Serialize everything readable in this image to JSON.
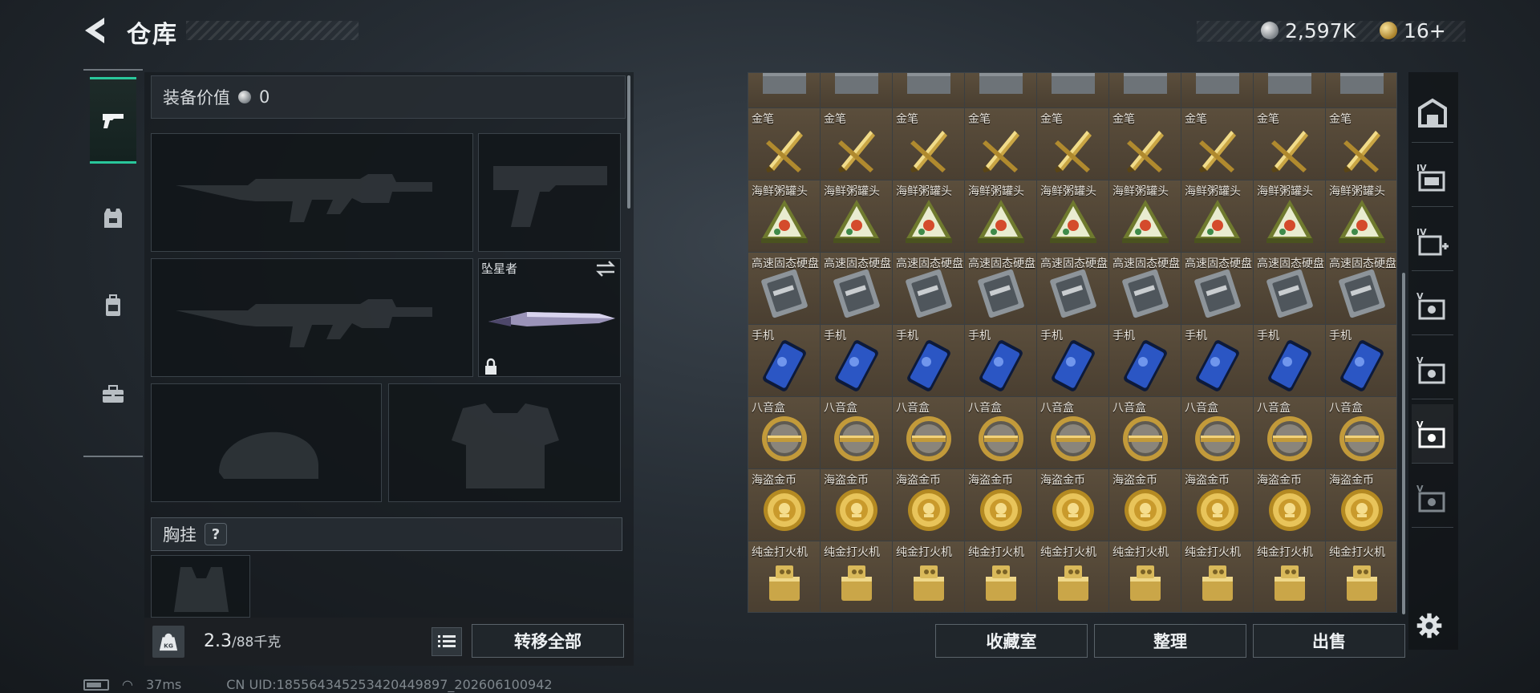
{
  "header": {
    "title": "仓库",
    "currency_silver": "2,597K",
    "currency_gold": "16+"
  },
  "sidebar": {
    "categories": [
      {
        "name": "pistol",
        "active": true
      },
      {
        "name": "armor-vest",
        "active": false
      },
      {
        "name": "backpack",
        "active": false
      },
      {
        "name": "toolbox",
        "active": false
      }
    ]
  },
  "equipment": {
    "value_label": "装备价值",
    "value": "0",
    "melee_name": "坠星者",
    "chest_rig_label": "胸挂",
    "help_mark": "?"
  },
  "weight": {
    "current": "2.3",
    "max": "/88千克"
  },
  "buttons": {
    "transfer_all": "转移全部",
    "collection": "收藏室",
    "sort": "整理",
    "sell": "出售"
  },
  "grid": {
    "columns": 9,
    "rows": [
      {
        "label": "",
        "icon": "box",
        "partial": true
      },
      {
        "label": "金笔",
        "icon": "gold-pen"
      },
      {
        "label": "海鲜粥罐头",
        "icon": "seafood-can"
      },
      {
        "label": "高速固态硬盘",
        "icon": "ssd"
      },
      {
        "label": "手机",
        "icon": "phone"
      },
      {
        "label": "八音盒",
        "icon": "music-box"
      },
      {
        "label": "海盗金币",
        "icon": "pirate-coin"
      },
      {
        "label": "纯金打火机",
        "icon": "gold-lighter"
      }
    ]
  },
  "status": {
    "ping": "37ms",
    "uid": "CN UID:185564345253420449897_202606100942"
  },
  "storage_tabs": [
    {
      "name": "storage-main",
      "active": false
    },
    {
      "name": "storage-iv",
      "active": false
    },
    {
      "name": "storage-iv-add",
      "active": false
    },
    {
      "name": "storage-v-1",
      "active": false
    },
    {
      "name": "storage-v-2",
      "active": false
    },
    {
      "name": "storage-v-3",
      "active": true
    },
    {
      "name": "storage-v-4",
      "active": false
    }
  ]
}
